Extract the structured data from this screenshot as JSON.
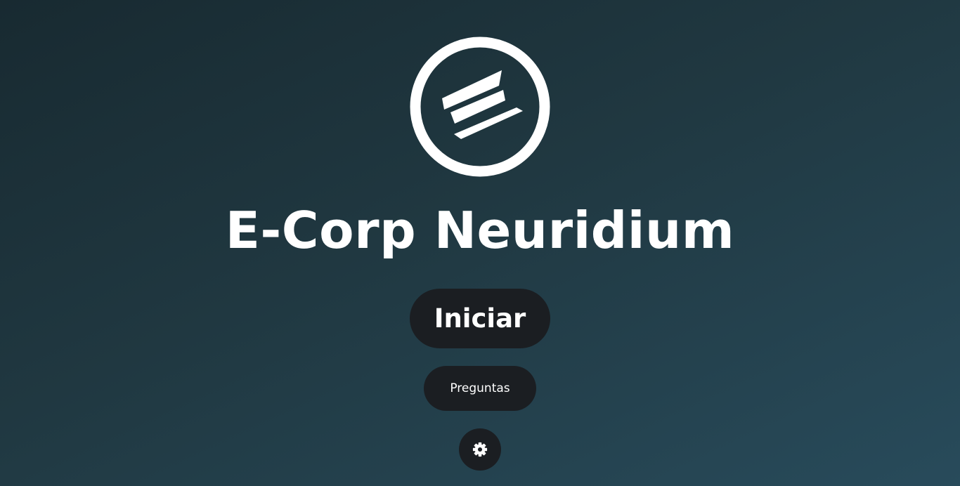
{
  "app": {
    "title": "E-Corp Neuridium"
  },
  "logo": {
    "icon": "e-corp-logo-icon"
  },
  "actions": {
    "start_label": "Iniciar",
    "faq_label": "Preguntas",
    "settings_icon": "gear-icon"
  },
  "colors": {
    "background_top": "#182a31",
    "background_bottom": "#284b5b",
    "button_bg": "#1b1e22",
    "text": "#ffffff"
  }
}
